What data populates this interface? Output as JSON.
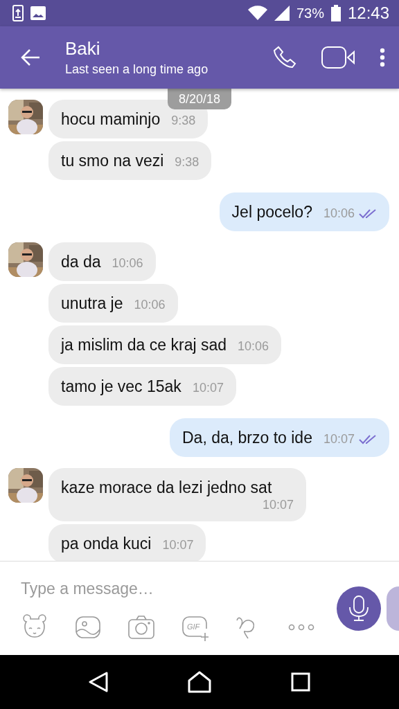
{
  "status_bar": {
    "battery": "73%",
    "time": "12:43"
  },
  "header": {
    "title": "Baki",
    "subtitle": "Last seen a long time ago"
  },
  "date_chip": "8/20/18",
  "messages": [
    {
      "kind": "in",
      "avatar": true,
      "text": "hocu maminjo",
      "time": "9:38",
      "read": false
    },
    {
      "kind": "in",
      "avatar": false,
      "text": "tu smo na vezi",
      "time": "9:38",
      "read": false
    },
    {
      "kind": "out",
      "avatar": false,
      "text": "Jel pocelo?",
      "time": "10:06",
      "read": true
    },
    {
      "kind": "in",
      "avatar": true,
      "text": "da da",
      "time": "10:06",
      "read": false
    },
    {
      "kind": "in",
      "avatar": false,
      "text": "unutra je",
      "time": "10:06",
      "read": false
    },
    {
      "kind": "in",
      "avatar": false,
      "text": "ja mislim da ce kraj sad",
      "time": "10:06",
      "read": false
    },
    {
      "kind": "in",
      "avatar": false,
      "text": "tamo je vec 15ak",
      "time": "10:07",
      "read": false
    },
    {
      "kind": "out",
      "avatar": false,
      "text": "Da, da, brzo to ide",
      "time": "10:07",
      "read": true
    },
    {
      "kind": "in",
      "avatar": true,
      "text": "kaze morace da lezi jedno sat",
      "time": "10:07",
      "read": false
    },
    {
      "kind": "in",
      "avatar": false,
      "text": "pa onda kuci",
      "time": "10:07",
      "read": false
    }
  ],
  "composer": {
    "placeholder": "Type a message…",
    "gif_label": "GIF"
  }
}
